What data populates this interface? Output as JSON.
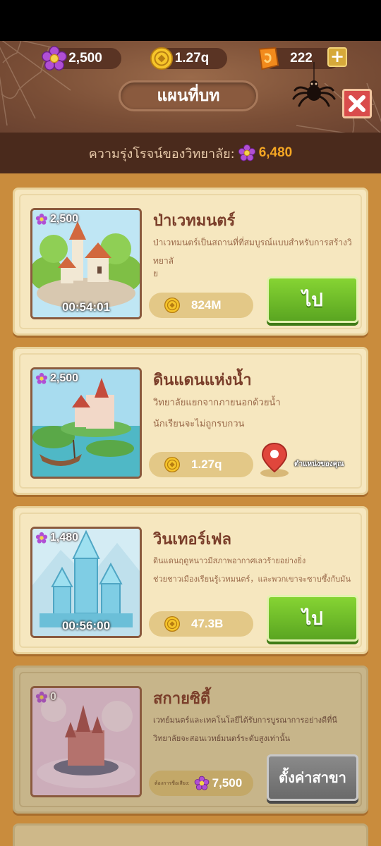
{
  "header": {
    "title": "แผนที่บท",
    "currencies": [
      {
        "icon": "purple-flower-icon",
        "value": "2,500"
      },
      {
        "icon": "gold-coin-icon",
        "value": "1.27q"
      },
      {
        "icon": "orange-gem-icon",
        "value": "222"
      }
    ]
  },
  "glory": {
    "label": "ความรุ่งโรจน์ของวิทยาลัย:",
    "value": "6,480"
  },
  "cards": [
    {
      "points": "2,500",
      "title": "ป่าเวทมนตร์",
      "desc_line1": "ป่าเวทมนตร์เป็นสถานที่ที่สมบูรณ์แบบสำหรับการสร้างวิทยาลั",
      "desc_line2": "ย",
      "timer": "00:54:01",
      "cost": "824M",
      "button": "ไป"
    },
    {
      "points": "2,500",
      "title": "ดินแดนแห่งน้ำ",
      "desc_line1": "วิทยาลัยแยกจากภายนอกด้วยน้ำ",
      "desc_line2": "นักเรียนจะไม่ถูกรบกวน",
      "cost": "1.27q",
      "location_label": "ตำแหน่งของคุณ"
    },
    {
      "points": "1,480",
      "title": "วินเทอร์เฟล",
      "desc_line1": "ดินแดนฤดูหนาวมีสภาพอากาศเลวร้ายอย่างยิ่ง",
      "desc_line2": "ช่วยชาวเมืองเรียนรู้เวทมนตร์，และพวกเขาจะซาบซึ้งกับมัน",
      "timer": "00:56:00",
      "cost": "47.3B",
      "button": "ไป"
    },
    {
      "points": "0",
      "title": "สกายซิตี้",
      "desc_line1": "เวทย์มนตร์และเทคโนโลยีได้รับการบูรณาการอย่างดีที่นี",
      "desc_line2": "วิทยาลัยจะสอนเวทย์มนตร์ระดับสูงเท่านั้น",
      "requirement_label": "ต้องการชื่อเสียง:",
      "requirement_value": "7,500",
      "button": "ตั้งค่าสาขา"
    }
  ],
  "colors": {
    "accent_green": "#6cbd27",
    "glory_orange": "#f5a623",
    "title_brown": "#7a3e2a",
    "close_red": "#d94c4c"
  }
}
